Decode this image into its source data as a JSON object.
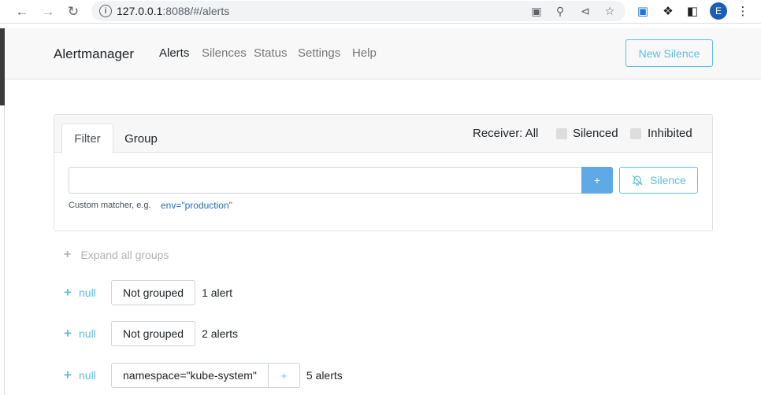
{
  "browser": {
    "url_host": "127.0.0.1",
    "url_rest": ":8088/#/alerts",
    "avatar_letter": "E"
  },
  "navbar": {
    "brand": "Alertmanager",
    "links": [
      "Alerts",
      "Silences",
      "Status",
      "Settings",
      "Help"
    ],
    "active": "Alerts",
    "new_silence_label": "New Silence"
  },
  "filter": {
    "tabs": [
      "Filter",
      "Group"
    ],
    "receiver_label": "Receiver: All",
    "silenced_label": "Silenced",
    "inhibited_label": "Inhibited",
    "input_value": "",
    "plus_label": "+",
    "silence_label": "Silence",
    "hint_text": "Custom matcher, e.g.",
    "hint_example": "env=\"production\""
  },
  "expand_all_label": "Expand all groups",
  "groups": [
    {
      "receiver": "null",
      "label": "Not grouped",
      "count": "1 alert"
    },
    {
      "receiver": "null",
      "label": "Not grouped",
      "count": "2 alerts"
    },
    {
      "receiver": "null",
      "label": "namespace=\"kube-system\"",
      "count": "5 alerts",
      "mini": "+"
    }
  ],
  "colors": {
    "accent": "#5bc0de",
    "primary_button": "#5fa9e6"
  }
}
